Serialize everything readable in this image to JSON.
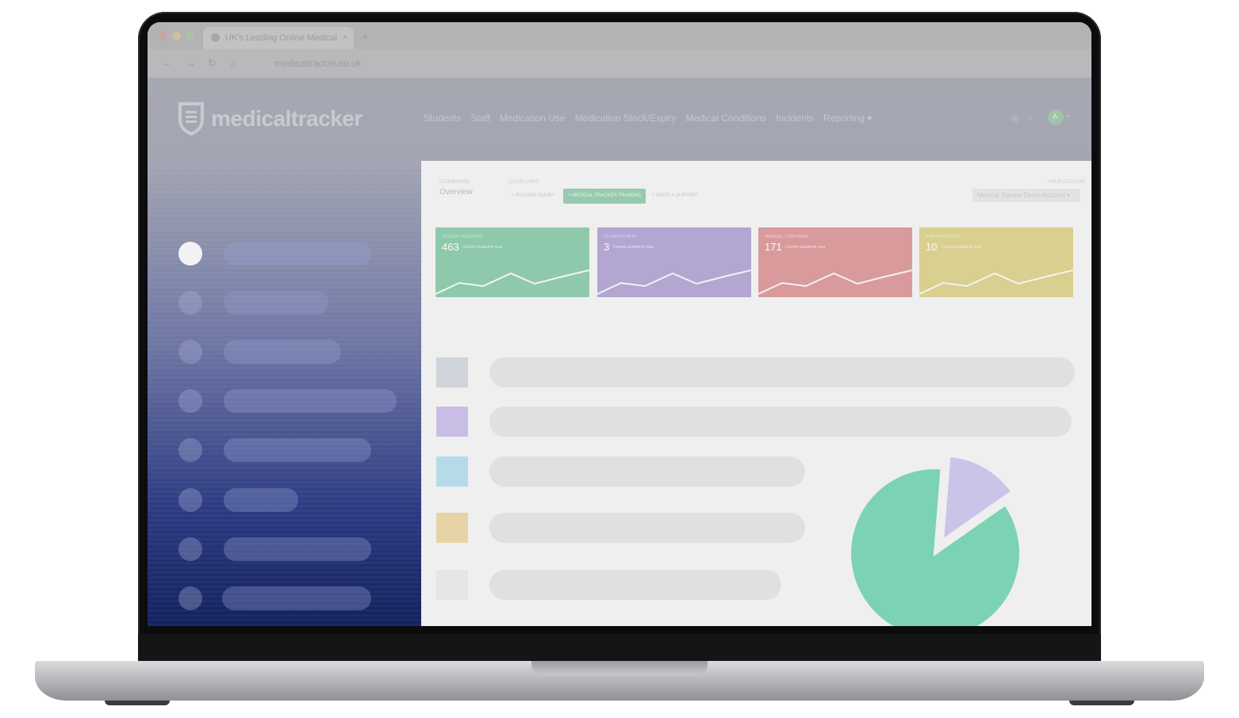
{
  "browser": {
    "tab_title": "UK's Leading Online Medical",
    "tab_close": "×",
    "new_tab": "+",
    "url": "medicaltracker.co.uk",
    "nav_icons": [
      "back-arrow",
      "forward-arrow",
      "reload",
      "home"
    ]
  },
  "app": {
    "logo_text": "medicaltracker",
    "nav": [
      "Students",
      "Staff",
      "Medication Use",
      "Medication Stock/Expiry",
      "Medical Conditions",
      "Incidents",
      "Reporting ▾"
    ],
    "avatar_initial": "A",
    "avatar_caret": "▾"
  },
  "dashboard": {
    "section_label": "DASHBOARD",
    "section_value": "Overview",
    "quick_links_label": "QUICK LINKS",
    "pills": [
      "+ RECORD INJURY",
      "+ MEDICAL TRACKER TRAINING",
      "+ RAISE A SUPPORT"
    ],
    "account_label": "YOUR ACCOUNT",
    "account_value": "Medical Tracker Demo Account ▾",
    "cards": [
      {
        "label": "STUDENT INCIDENTS",
        "value": "463",
        "sub": "Current academic year",
        "color": "#8ec9ac"
      },
      {
        "label": "STUDENTS WITH",
        "value": "3",
        "sub": "Current academic year",
        "color": "#b3a6d1"
      },
      {
        "label": "MEDICAL CONDITIONS",
        "value": "171",
        "sub": "Current academic year",
        "color": "#d99a9c"
      },
      {
        "label": "STAFF INCIDENTS",
        "value": "10",
        "sub": "Current academic year",
        "color": "#d9cf8e"
      }
    ],
    "legend_colors": [
      "#cfd4da",
      "#c9bde6",
      "#b5dbe8",
      "#e6d4a6",
      "#e6e6e6",
      "#ade3f2"
    ]
  },
  "chart_data": {
    "type": "pie",
    "values": [
      86,
      14
    ],
    "colors": [
      "#7cd3b3",
      "#cbc3e8"
    ]
  }
}
